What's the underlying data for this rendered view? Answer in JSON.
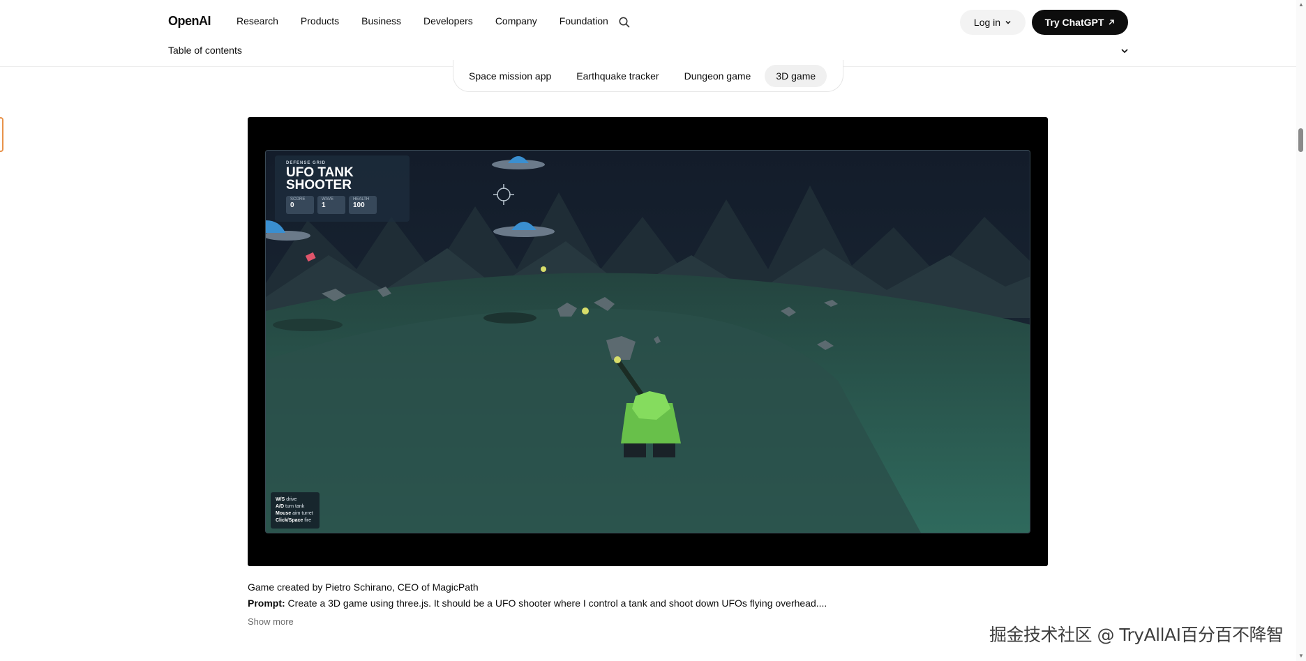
{
  "nav": {
    "logo": "OpenAI",
    "links": [
      "Research",
      "Products",
      "Business",
      "Developers",
      "Company",
      "Foundation"
    ],
    "login_label": "Log in",
    "try_label": "Try ChatGPT",
    "toc_label": "Table of contents"
  },
  "tabs": {
    "items": [
      "Space mission app",
      "Earthquake tracker",
      "Dungeon game",
      "3D game"
    ],
    "active": "3D game"
  },
  "game": {
    "hud_subtitle": "DEFENSE GRID",
    "hud_title_line1": "UFO TANK",
    "hud_title_line2": "SHOOTER",
    "score_label": "SCORE",
    "score_value": "0",
    "wave_label": "WAVE",
    "wave_value": "1",
    "health_label": "HEALTH",
    "health_value": "100",
    "controls": [
      {
        "key": "W/S",
        "action": "drive"
      },
      {
        "key": "A/D",
        "action": "turn tank"
      },
      {
        "key": "Mouse",
        "action": "aim turret"
      },
      {
        "key": "Click/Space",
        "action": "fire"
      }
    ]
  },
  "caption": {
    "credit": "Game created by Pietro Schirano, CEO of MagicPath",
    "prompt_label": "Prompt:",
    "prompt_text": " Create a 3D game using three.js. It should be a UFO shooter where I control a tank and shoot down UFOs flying overhead....",
    "show_more": "Show more"
  },
  "watermark": "掘金技术社区 @ TryAllAI百分百不降智",
  "colors": {
    "accent_dark": "#0d0d0d",
    "marker": "#e8924a",
    "ground": "#2f5f58",
    "tank": "#6fcf4a"
  },
  "icons": {
    "search": "search-icon",
    "login_chevron": "chevron-down-icon",
    "try_arrow": "arrow-up-right-icon",
    "toc_chevron": "chevron-down-icon"
  }
}
